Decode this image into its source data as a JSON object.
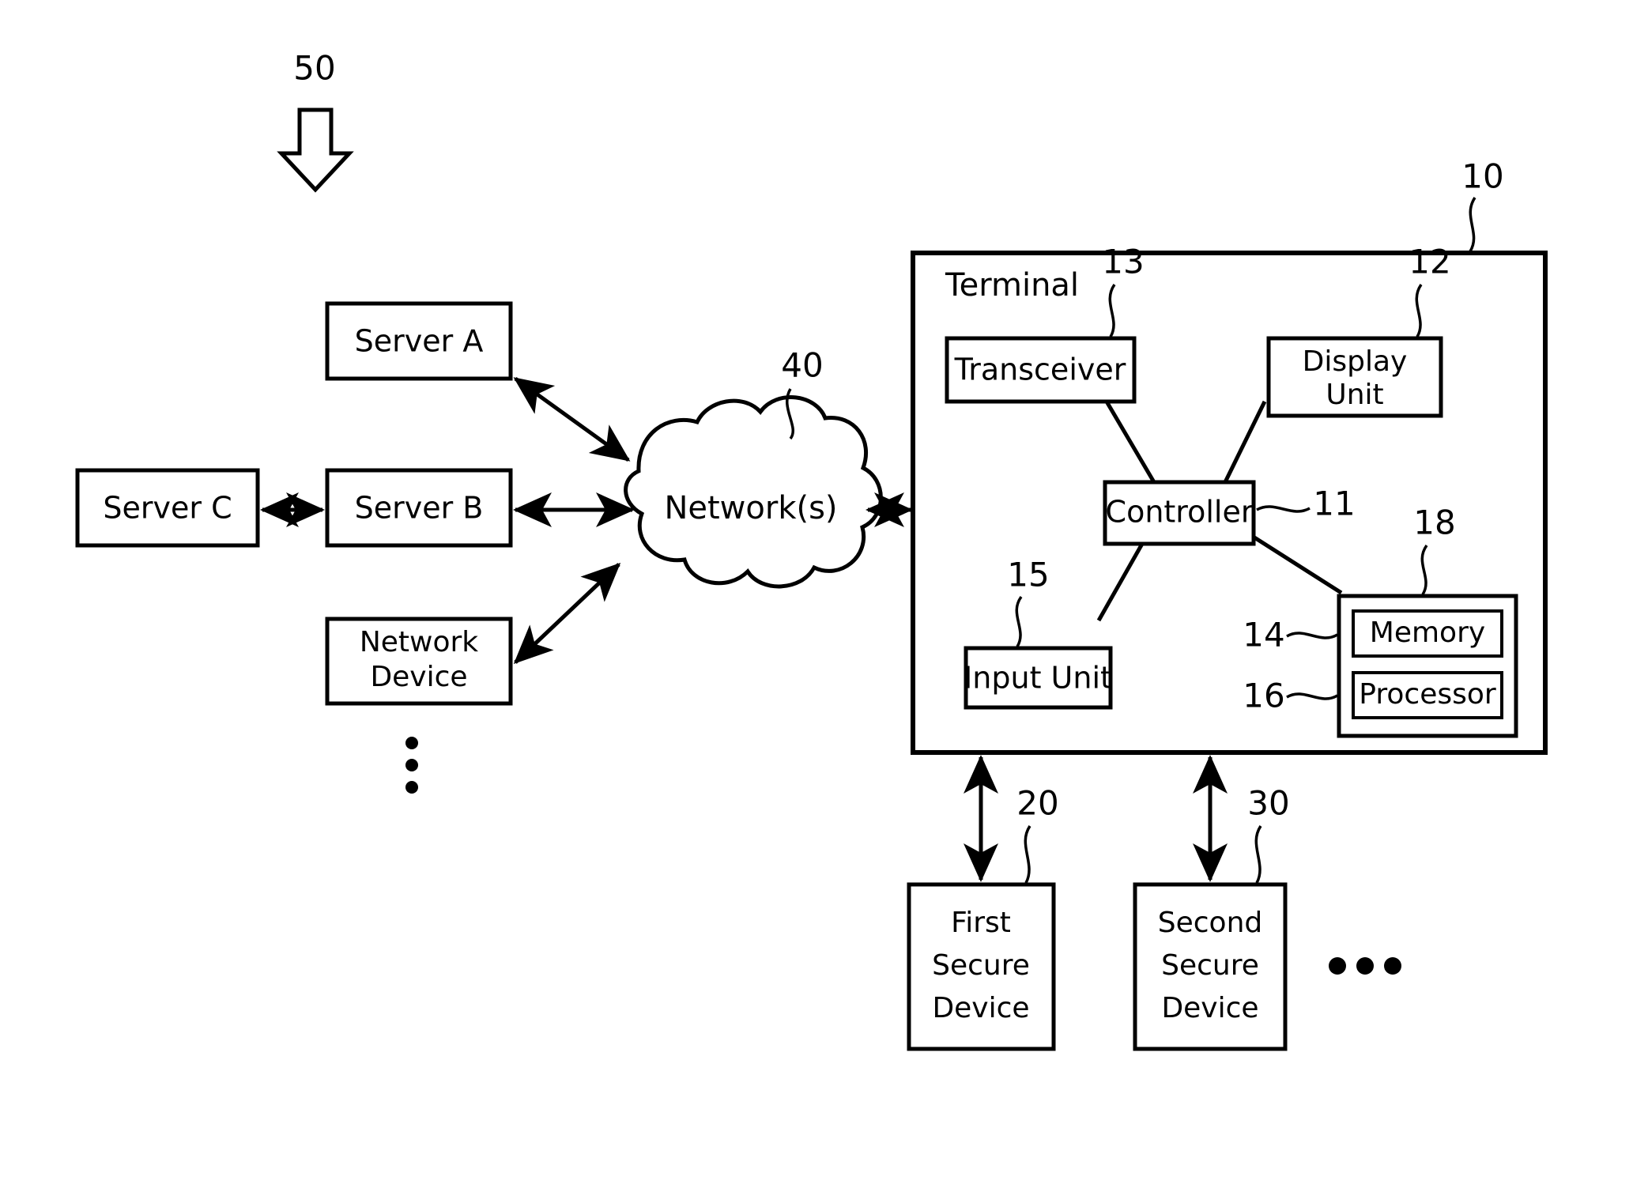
{
  "figure": {
    "title": "System block diagram",
    "background_color": "#ffffff",
    "line_color": "#000000"
  },
  "system_arrow": {
    "ref": "50",
    "direction": "down"
  },
  "network_side": {
    "cloud": {
      "label": "Network(s)",
      "ref": "40"
    },
    "nodes": [
      {
        "id": "server-a",
        "label": "Server A",
        "ref": ""
      },
      {
        "id": "server-b",
        "label": "Server B",
        "ref": ""
      },
      {
        "id": "server-c",
        "label": "Server C",
        "ref": ""
      },
      {
        "id": "network-device",
        "label_line1": "Network",
        "label_line2": "Device",
        "ref": ""
      }
    ],
    "more_indicator": "vertical-ellipsis"
  },
  "terminal": {
    "title": "Terminal",
    "ref": "10",
    "components": [
      {
        "id": "transceiver",
        "label": "Transceiver",
        "ref": "13"
      },
      {
        "id": "display-unit",
        "label_line1": "Display",
        "label_line2": "Unit",
        "ref": "12"
      },
      {
        "id": "controller",
        "label": "Controller",
        "ref": "11"
      },
      {
        "id": "input-unit",
        "label": "Input Unit",
        "ref": "15"
      },
      {
        "id": "memory-processor-group",
        "label": "",
        "ref": "18"
      },
      {
        "id": "memory",
        "label": "Memory",
        "ref": "14"
      },
      {
        "id": "processor",
        "label": "Processor",
        "ref": "16"
      }
    ]
  },
  "secure_devices": [
    {
      "id": "first-secure-device",
      "label_line1": "First",
      "label_line2": "Secure",
      "label_line3": "Device",
      "ref": "20"
    },
    {
      "id": "second-secure-device",
      "label_line1": "Second",
      "label_line2": "Secure",
      "label_line3": "Device",
      "ref": "30"
    }
  ],
  "secure_devices_more_indicator": "horizontal-ellipsis"
}
